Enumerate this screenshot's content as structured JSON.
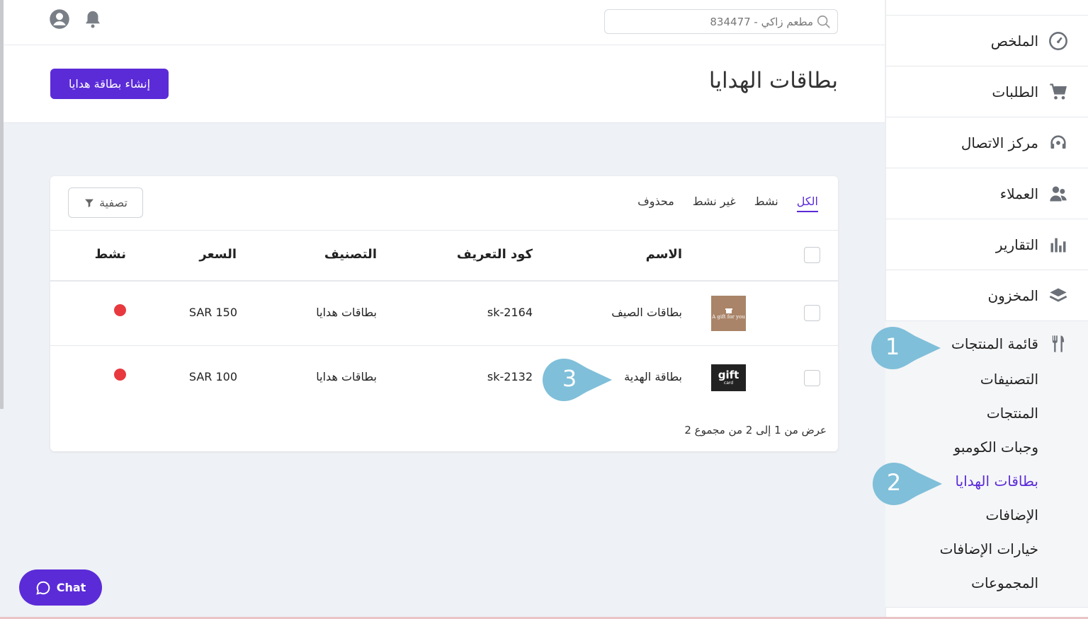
{
  "header": {
    "search_value": "مطعم زاكي - 834477"
  },
  "page": {
    "title": "بطاقات الهدايا",
    "create_button": "إنشاء بطاقة هدايا"
  },
  "sidebar": {
    "items": [
      {
        "label": "الملخص",
        "icon": "dashboard-gauge-icon"
      },
      {
        "label": "الطلبات",
        "icon": "cart-icon"
      },
      {
        "label": "مركز الاتصال",
        "icon": "headset-icon"
      },
      {
        "label": "العملاء",
        "icon": "users-icon"
      },
      {
        "label": "التقارير",
        "icon": "bar-chart-icon"
      },
      {
        "label": "المخزون",
        "icon": "layers-icon"
      }
    ],
    "group": {
      "label": "قائمة المنتجات",
      "icon": "fork-knife-icon",
      "children": [
        "التصنيفات",
        "المنتجات",
        "وجبات الكومبو",
        "بطاقات الهدايا",
        "الإضافات",
        "خيارات الإضافات",
        "المجموعات"
      ],
      "active_index": 3
    }
  },
  "card": {
    "tabs": [
      "الكل",
      "نشط",
      "غير نشط",
      "محذوف"
    ],
    "active_tab": 0,
    "filter_label": "تصفية",
    "columns": {
      "name": "الاسم",
      "code": "كود التعريف",
      "category": "التصنيف",
      "price": "السعر",
      "active": "نشط"
    },
    "rows": [
      {
        "name": "بطاقات الصيف",
        "code": "sk-2164",
        "category": "بطاقات هدايا",
        "price": "SAR 150",
        "thumb_text": "A gift for you",
        "active_color": "#e8393f"
      },
      {
        "name": "بطاقة الهدية",
        "code": "sk-2132",
        "category": "بطاقات هدايا",
        "price": "SAR 100",
        "thumb_text": "gift",
        "thumb_sub": "card",
        "active_color": "#e8393f"
      }
    ],
    "pagination": "عرض من 1 إلى 2 من مجموع 2"
  },
  "callouts": [
    {
      "number": "1"
    },
    {
      "number": "2"
    },
    {
      "number": "3"
    }
  ],
  "chat": {
    "label": "Chat"
  },
  "colors": {
    "primary": "#5b2bd8",
    "callout": "#7fbfd9",
    "inactive_dot": "#e8393f"
  }
}
